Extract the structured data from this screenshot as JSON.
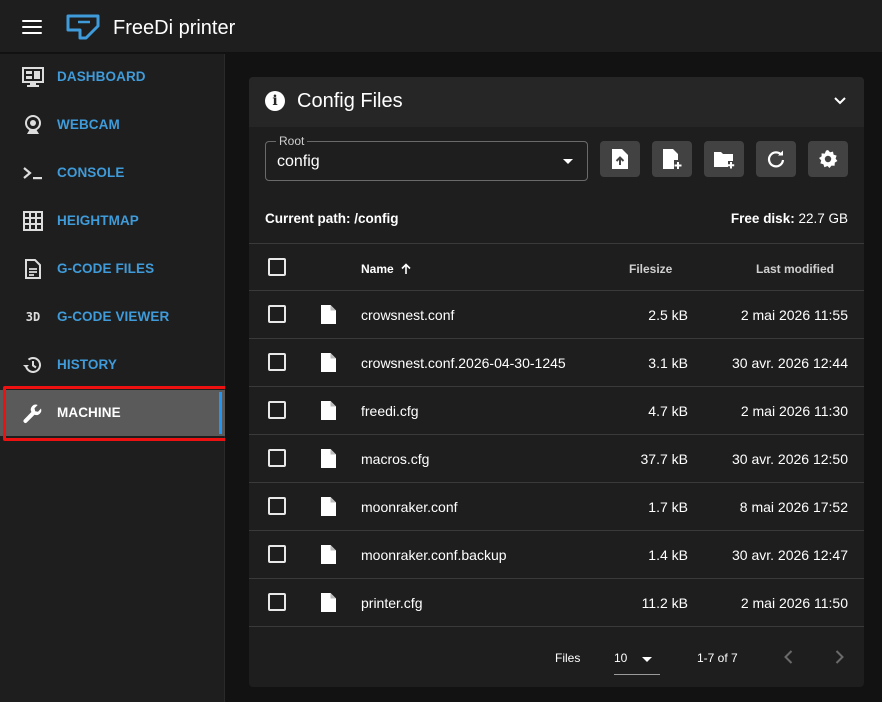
{
  "app": {
    "title": "FreeDi printer"
  },
  "sidebar": {
    "items": [
      {
        "label": "DASHBOARD",
        "icon": "monitor-dashboard-icon"
      },
      {
        "label": "WEBCAM",
        "icon": "webcam-icon"
      },
      {
        "label": "CONSOLE",
        "icon": "console-icon"
      },
      {
        "label": "HEIGHTMAP",
        "icon": "grid-icon"
      },
      {
        "label": "G-CODE FILES",
        "icon": "file-document-icon"
      },
      {
        "label": "G-CODE VIEWER",
        "icon": "3d-icon"
      },
      {
        "label": "HISTORY",
        "icon": "history-icon"
      },
      {
        "label": "MACHINE",
        "icon": "wrench-icon"
      }
    ],
    "active": "MACHINE",
    "accent": "#3f9bd9"
  },
  "config": {
    "title": "Config Files",
    "root_label": "Root",
    "root_value": "config",
    "current_path_label": "Current path: /config",
    "free_disk_label": "Free disk:",
    "free_disk_value": "22.7 GB",
    "toolbar_icons": [
      "upload-file-icon",
      "new-file-icon",
      "new-folder-icon",
      "refresh-icon",
      "settings-icon"
    ]
  },
  "table": {
    "headers": {
      "name": "Name",
      "size": "Filesize",
      "modified": "Last modified"
    },
    "rows": [
      {
        "name": "crowsnest.conf",
        "size": "2.5 kB",
        "modified": "2 mai 2026 11:55"
      },
      {
        "name": "crowsnest.conf.2026-04-30-1245",
        "size": "3.1 kB",
        "modified": "30 avr. 2026 12:44"
      },
      {
        "name": "freedi.cfg",
        "size": "4.7 kB",
        "modified": "2 mai 2026 11:30"
      },
      {
        "name": "macros.cfg",
        "size": "37.7 kB",
        "modified": "30 avr. 2026 12:50"
      },
      {
        "name": "moonraker.conf",
        "size": "1.7 kB",
        "modified": "8 mai 2026 17:52"
      },
      {
        "name": "moonraker.conf.backup",
        "size": "1.4 kB",
        "modified": "30 avr. 2026 12:47"
      },
      {
        "name": "printer.cfg",
        "size": "11.2 kB",
        "modified": "2 mai 2026 11:50"
      }
    ]
  },
  "pagination": {
    "files_label": "Files",
    "per_page": "10",
    "range": "1-7 of 7"
  }
}
